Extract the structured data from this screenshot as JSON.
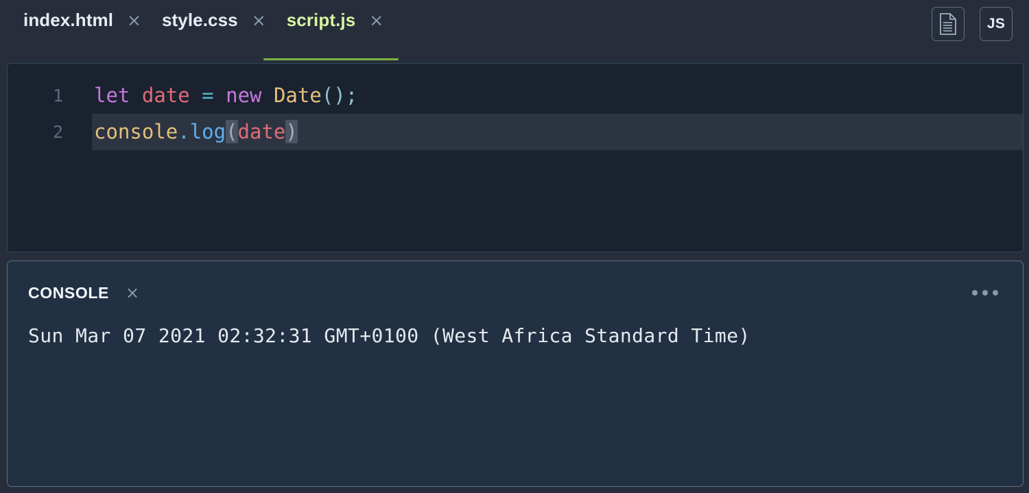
{
  "tabbar": {
    "tabs": [
      {
        "label": "index.html",
        "close": "×",
        "active": false
      },
      {
        "label": "style.css",
        "close": "×",
        "active": false
      },
      {
        "label": "script.js",
        "close": "×",
        "active": true
      }
    ],
    "icons": [
      {
        "name": "document-icon",
        "label": ""
      },
      {
        "name": "js-badge-icon",
        "label": "JS"
      }
    ],
    "active_tab_underline_color": "#7cb342",
    "active_tab_text_color": "#d8f5a2"
  },
  "editor": {
    "background": "#1a2230",
    "active_line_background": "#2c3442",
    "lines": [
      {
        "number": "1",
        "active": false,
        "tokens": [
          {
            "text": "let",
            "kind": "keyword",
            "color": "#c678dd"
          },
          {
            "text": " ",
            "kind": "plain",
            "color": "#abb2bf"
          },
          {
            "text": "date",
            "kind": "variable",
            "color": "#e06c75"
          },
          {
            "text": " ",
            "kind": "plain",
            "color": "#abb2bf"
          },
          {
            "text": "=",
            "kind": "operator",
            "color": "#56b6c2"
          },
          {
            "text": " ",
            "kind": "plain",
            "color": "#abb2bf"
          },
          {
            "text": "new",
            "kind": "keyword",
            "color": "#c678dd"
          },
          {
            "text": " ",
            "kind": "plain",
            "color": "#abb2bf"
          },
          {
            "text": "Date",
            "kind": "class",
            "color": "#e5c07b"
          },
          {
            "text": "()",
            "kind": "punctuation",
            "color": "#8fc3cc"
          },
          {
            "text": ";",
            "kind": "punctuation",
            "color": "#8fc3cc"
          }
        ]
      },
      {
        "number": "2",
        "active": true,
        "tokens": [
          {
            "text": "console",
            "kind": "object",
            "color": "#e5c07b"
          },
          {
            "text": ".",
            "kind": "dot",
            "color": "#56b6c2"
          },
          {
            "text": "log",
            "kind": "function",
            "color": "#61afef"
          },
          {
            "text": "(",
            "kind": "bracket-highlight",
            "color": "#9fb0bf"
          },
          {
            "text": "date",
            "kind": "variable",
            "color": "#e06c75"
          },
          {
            "text": ")",
            "kind": "bracket-highlight",
            "color": "#9fb0bf"
          }
        ]
      }
    ]
  },
  "console": {
    "title": "CONSOLE",
    "close": "×",
    "more_menu": "…",
    "background": "#213042",
    "output": [
      "Sun Mar 07 2021 02:32:31 GMT+0100 (West Africa Standard Time)"
    ]
  }
}
